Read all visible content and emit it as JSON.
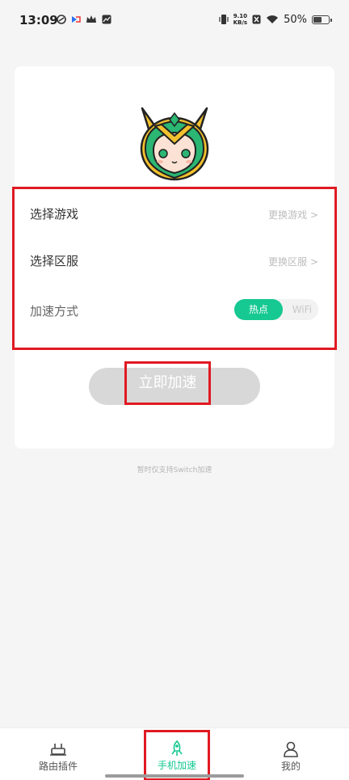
{
  "status_bar": {
    "time": "13:09",
    "net_speed_value": "9.10",
    "net_speed_unit": "KB/s",
    "battery_percent": "50%",
    "battery_level": 0.5
  },
  "mascot": {
    "icon": "loki-mascot-icon"
  },
  "options": {
    "game": {
      "label": "选择游戏",
      "action": "更换游戏 >"
    },
    "server": {
      "label": "选择区服",
      "action": "更换区服 >"
    },
    "mode": {
      "label": "加速方式",
      "selected": "热点",
      "other": "WiFi"
    }
  },
  "accelerate_label": "立即加速",
  "notice": "暂时仅支持Switch加速",
  "tabs": [
    {
      "label": "路由插件",
      "icon": "router-icon"
    },
    {
      "label": "手机加速",
      "icon": "rocket-icon"
    },
    {
      "label": "我的",
      "icon": "profile-icon"
    }
  ],
  "colors": {
    "accent": "#16c891",
    "highlight": "#e01a22"
  }
}
